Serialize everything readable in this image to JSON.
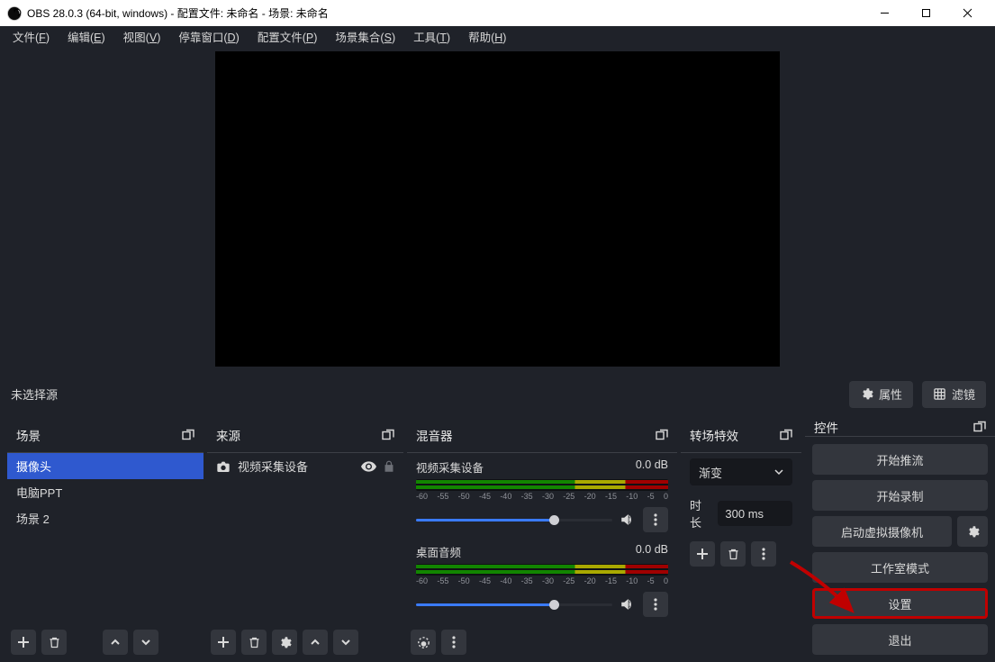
{
  "titlebar": {
    "title": "OBS 28.0.3 (64-bit, windows) - 配置文件: 未命名 - 场景: 未命名"
  },
  "menu": {
    "file": "文件(",
    "file_u": "F",
    "file2": ")",
    "edit": "编辑(",
    "edit_u": "E",
    "edit2": ")",
    "view": "视图(",
    "view_u": "V",
    "view2": ")",
    "docks": "停靠窗口(",
    "docks_u": "D",
    "docks2": ")",
    "profile": "配置文件(",
    "profile_u": "P",
    "profile2": ")",
    "scenecol": "场景集合(",
    "scenecol_u": "S",
    "scenecol2": ")",
    "tools": "工具(",
    "tools_u": "T",
    "tools2": ")",
    "help": "帮助(",
    "help_u": "H",
    "help2": ")"
  },
  "propbar": {
    "no_source": "未选择源",
    "properties": "属性",
    "filters": "滤镜"
  },
  "panels": {
    "scenes": "场景",
    "sources": "来源",
    "mixer": "混音器",
    "transitions": "转场特效",
    "controls": "控件"
  },
  "scenes": {
    "items": [
      "摄像头",
      "电脑PPT",
      "场景 2"
    ]
  },
  "sources": {
    "items": [
      {
        "label": "视频采集设备"
      }
    ]
  },
  "mixer": {
    "ch": [
      {
        "name": "视频采集设备",
        "db": "0.0 dB"
      },
      {
        "name": "桌面音频",
        "db": "0.0 dB"
      }
    ],
    "ticks": [
      "-60",
      "-55",
      "-50",
      "-45",
      "-40",
      "-35",
      "-30",
      "-25",
      "-20",
      "-15",
      "-10",
      "-5",
      "0"
    ]
  },
  "trans": {
    "type": "渐变",
    "dur_label": "时长",
    "dur_value": "300 ms"
  },
  "controls": {
    "stream": "开始推流",
    "record": "开始录制",
    "vcam": "启动虚拟摄像机",
    "studio": "工作室模式",
    "settings": "设置",
    "exit": "退出"
  }
}
